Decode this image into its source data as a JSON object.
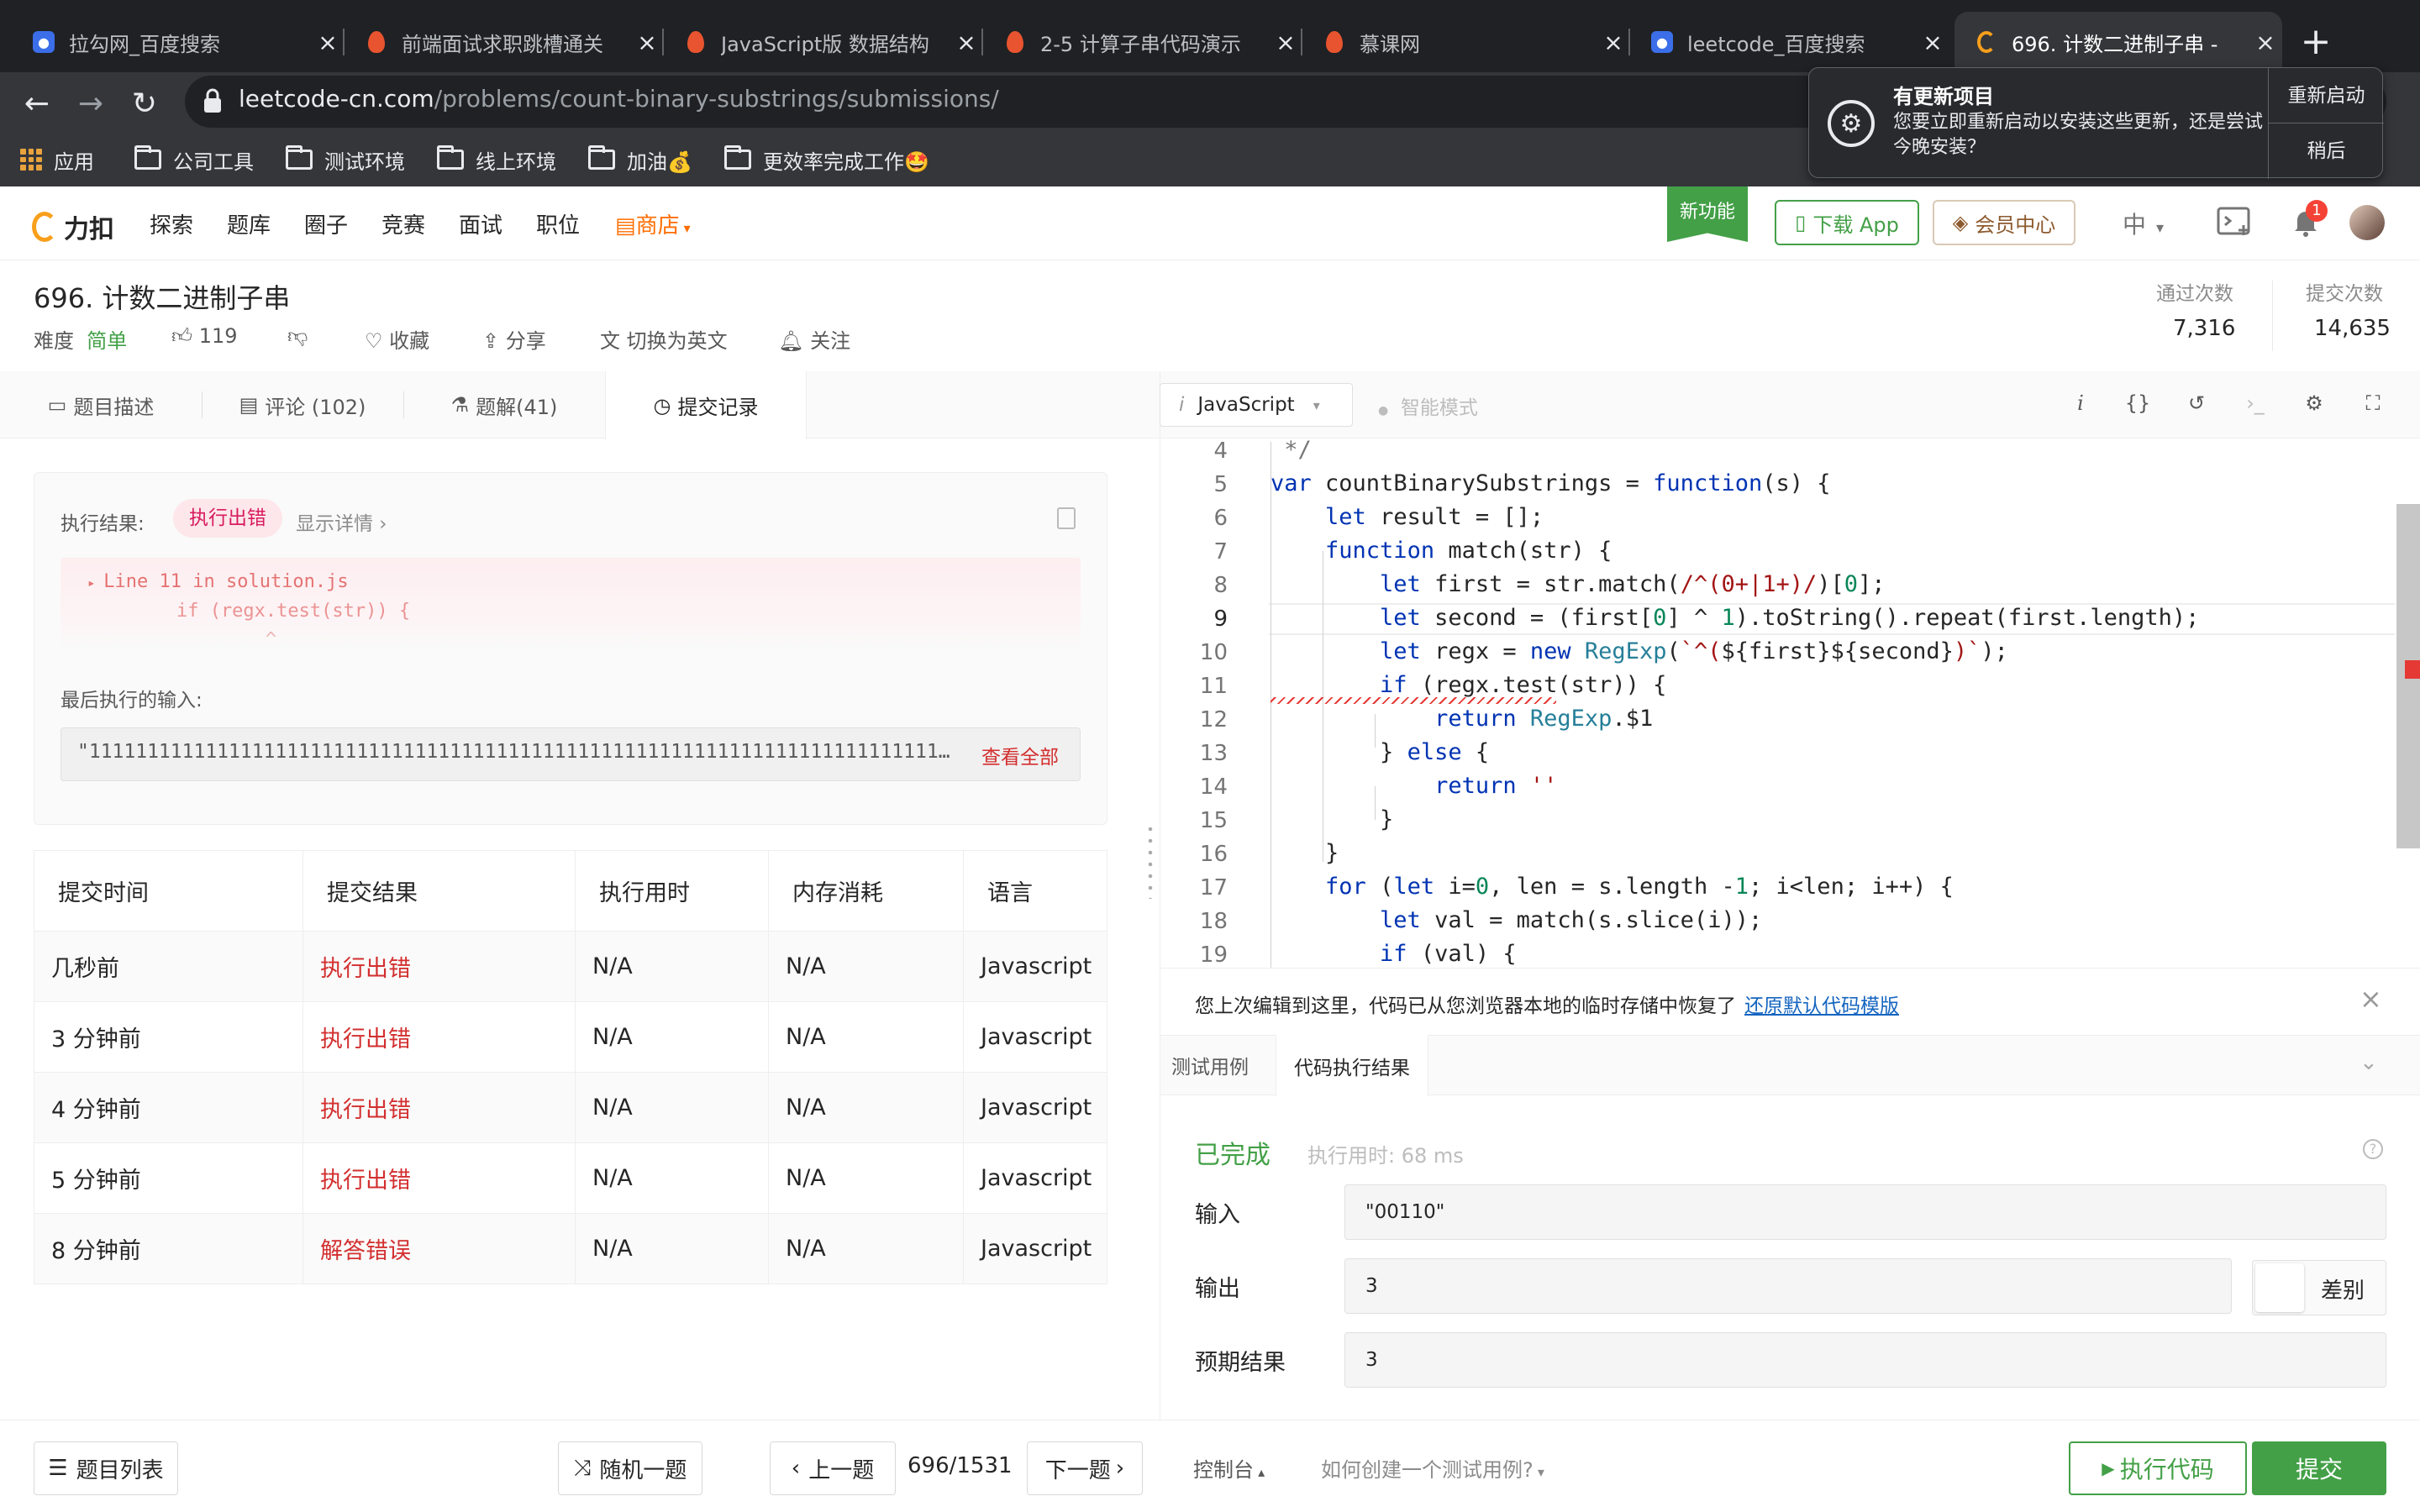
{
  "browser": {
    "tabs": [
      {
        "title": "拉勾网_百度搜索",
        "icon": "baidu-paw-icon"
      },
      {
        "title": "前端面试求职跳槽通关",
        "icon": "imooc-flame-icon"
      },
      {
        "title": "JavaScript版 数据结构",
        "icon": "imooc-flame-icon"
      },
      {
        "title": "2-5 计算子串代码演示",
        "icon": "imooc-flame-icon"
      },
      {
        "title": "慕课网",
        "icon": "imooc-flame-icon"
      },
      {
        "title": "leetcode_百度搜索",
        "icon": "baidu-paw-icon"
      },
      {
        "title": "696. 计数二进制子串 -",
        "icon": "leetcode-logo-icon",
        "active": true
      }
    ],
    "url_host": "leetcode-cn.com",
    "url_path": "/problems/count-binary-substrings/submissions/",
    "bookmarks": [
      "应用",
      "公司工具",
      "测试环境",
      "线上环境",
      "加油💰",
      "更效率完成工作🤩"
    ],
    "update_popup": {
      "title": "有更新项目",
      "message": "您要立即重新启动以安装这些更新，还是尝试今晚安装？",
      "restart": "重新启动",
      "later": "稍后"
    }
  },
  "site": {
    "logo_text": "力扣",
    "nav": [
      "探索",
      "题库",
      "圈子",
      "竞赛",
      "面试",
      "职位"
    ],
    "shop": "商店",
    "new_feature": "新功能",
    "download_app": "下载 App",
    "vip": "会员中心",
    "lang": "中",
    "notification_count": "1"
  },
  "problem": {
    "title": "696. 计数二进制子串",
    "difficulty_label": "难度",
    "difficulty": "简单",
    "likes": "119",
    "favorite": "收藏",
    "share": "分享",
    "switch_lang": "切换为英文",
    "follow": "关注",
    "accepted_label": "通过次数",
    "accepted": "7,316",
    "submissions_label": "提交次数",
    "submissions": "14,635"
  },
  "left_tabs": [
    "题目描述",
    "评论 (102)",
    "题解(41)",
    "提交记录"
  ],
  "result": {
    "label": "执行结果:",
    "status": "执行出错",
    "details": "显示详情 ›",
    "error_line1": "Line 11 in solution.js",
    "error_line2": "        if (regx.test(str)) {",
    "error_line3": "                ^",
    "last_input_label": "最后执行的输入:",
    "last_input": "\"111111111111111111111111111111111111111111111111111111111111111111111111111111111111111111111111111111",
    "view_all": "查看全部"
  },
  "submissions_table": {
    "headers": [
      "提交时间",
      "提交结果",
      "执行用时",
      "内存消耗",
      "语言"
    ],
    "rows": [
      [
        "几秒前",
        "执行出错",
        "N/A",
        "N/A",
        "Javascript"
      ],
      [
        "3 分钟前",
        "执行出错",
        "N/A",
        "N/A",
        "Javascript"
      ],
      [
        "4 分钟前",
        "执行出错",
        "N/A",
        "N/A",
        "Javascript"
      ],
      [
        "5 分钟前",
        "执行出错",
        "N/A",
        "N/A",
        "Javascript"
      ],
      [
        "8 分钟前",
        "解答错误",
        "N/A",
        "N/A",
        "Javascript"
      ]
    ]
  },
  "editor": {
    "language": "JavaScript",
    "smart_mode": "智能模式",
    "line_numbers": [
      "4",
      "5",
      "6",
      "7",
      "8",
      "9",
      "10",
      "11",
      "12",
      "13",
      "14",
      "15",
      "16",
      "17",
      "18",
      "19"
    ],
    "restore_message": "您上次编辑到这里，代码已从您浏览器本地的临时存储中恢复了",
    "restore_link": "还原默认代码模版"
  },
  "bottom_tabs": [
    "测试用例",
    "代码执行结果"
  ],
  "run_result": {
    "status": "已完成",
    "time": "执行用时: 68 ms",
    "input_label": "输入",
    "input": "\"00110\"",
    "output_label": "输出",
    "output": "3",
    "diff": "差别",
    "expected_label": "预期结果",
    "expected": "3"
  },
  "footer": {
    "problem_list": "题目列表",
    "random": "随机一题",
    "prev": "上一题",
    "page": "696/1531",
    "next": "下一题",
    "console": "控制台",
    "howto": "如何创建一个测试用例?",
    "run": "执行代码",
    "submit": "提交"
  },
  "colors": {
    "accent_green": "#43a047",
    "error_red": "#d32f2f",
    "shop_orange": "#ff6d00"
  }
}
